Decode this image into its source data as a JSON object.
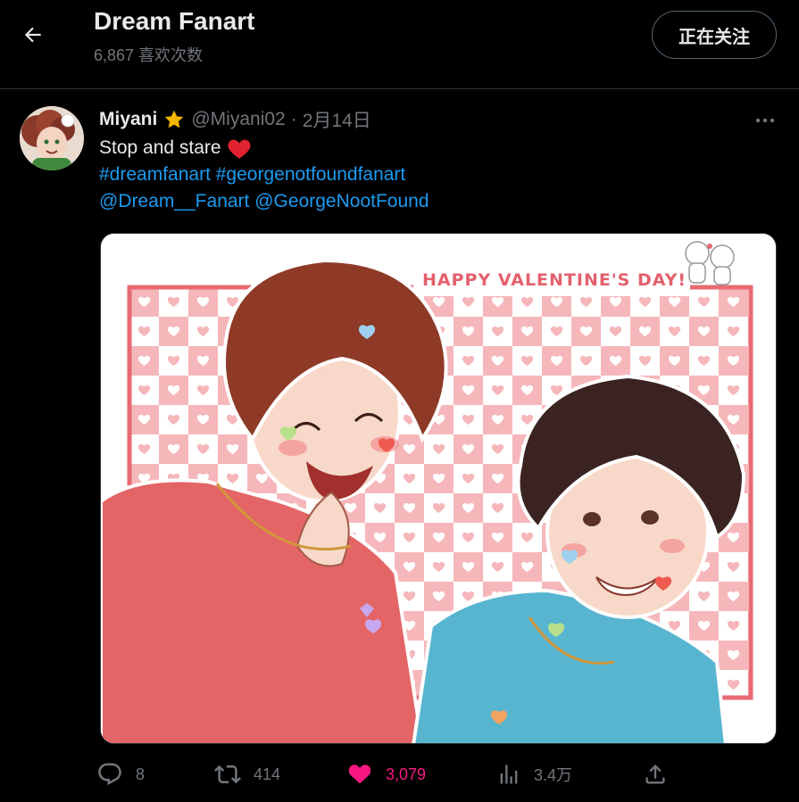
{
  "header": {
    "title": "Dream Fanart",
    "subtitle": "6,867 喜欢次数",
    "follow_label": "正在关注",
    "back_icon": "arrow-left-icon"
  },
  "tweet": {
    "author_name": "Miyani",
    "verified_icon": "star-icon",
    "handle": "@Miyani02",
    "separator": "·",
    "date": "2月14日",
    "text": "Stop and stare",
    "emoji": "heart-emoji",
    "hashtags": [
      "#dreamfanart",
      "#georgenotfoundfanart"
    ],
    "mentions": [
      "@Dream__Fanart",
      "@GeorgeNootFound"
    ],
    "image": {
      "banner_text": "HAPPY VALENTINE'S DAY!",
      "alt": "Two illustrated characters on pink checkered background"
    }
  },
  "actions": {
    "reply_count": "8",
    "retweet_count": "414",
    "like_count": "3,079",
    "views_count": "3.4万"
  },
  "colors": {
    "background": "#000000",
    "text": "#e7e9ea",
    "muted": "#71767b",
    "link": "#1d9bf0",
    "like": "#f91880",
    "border": "#2f3336"
  }
}
